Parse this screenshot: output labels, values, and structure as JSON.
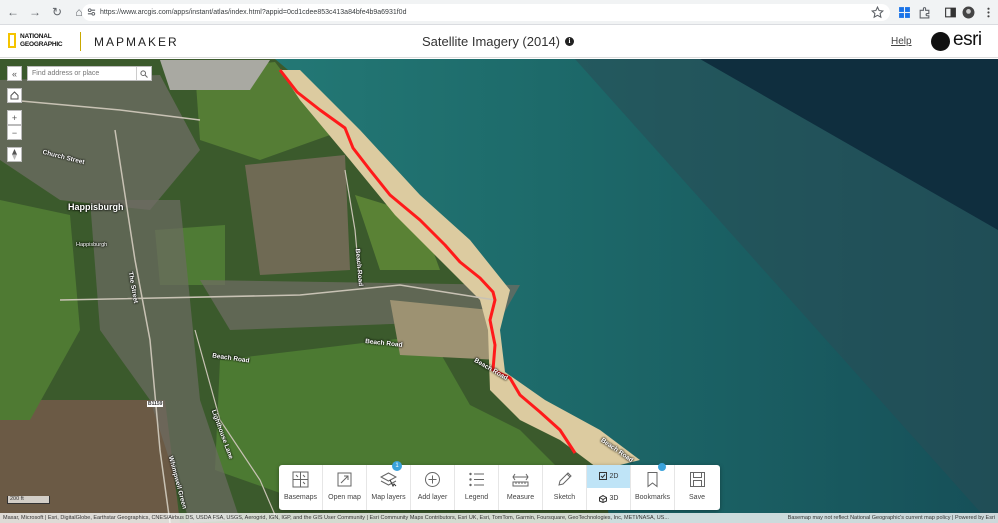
{
  "browser": {
    "url": "https://www.arcgis.com/apps/instant/atlas/index.html?appid=0cd1cdee853c413a84bfe4b9a6931f0d"
  },
  "header": {
    "brand_line1": "NATIONAL",
    "brand_line2": "GEOGRAPHIC",
    "app_name": "MAPMAKER",
    "map_title": "Satellite Imagery (2014)",
    "info_glyph": "i",
    "help_label": "Help",
    "esri_logo": "esri"
  },
  "map": {
    "search_placeholder": "Find address or place",
    "collapse_glyph": "«",
    "zoom_in_glyph": "+",
    "zoom_out_glyph": "−",
    "labels": {
      "church_street": "Church Street",
      "happisburgh": "Happisburgh",
      "beach_road_west": "Beach Road",
      "beach_road_mid": "Beach Road",
      "beach_road_east": "Beach Road",
      "beach_road_vertical": "Beach Road",
      "the_street": "The Street",
      "lighthouse_lane": "Lighthouse Lane",
      "whimpwell_green": "Whimpwell Green",
      "b1159": "B1159",
      "b1159_2": "B1159",
      "hadisburgh": "Happisburgh"
    },
    "scale_label": "200 ft",
    "attribution_left": "Maxar, Microsoft | Esri, DigitalGlobe, Earthstar Geographics, CNES/Airbus DS, USDA FSA, USGS, Aerogrid, IGN, IGP, and the GIS User Community | Esri Community Maps Contributors, Esri UK, Esri, TomTom, Garmin, Foursquare, GeoTechnologies, Inc, METI/NASA, US...",
    "attribution_right": "Basemap may not reflect National Geographic's current map policy | Powered by Esri",
    "colors": {
      "sea": "#1f6f6c",
      "land": "#3d5a2a",
      "route": "#ff1a1a"
    }
  },
  "toolbar": {
    "tools": [
      {
        "name": "basemaps",
        "label": "Basemaps"
      },
      {
        "name": "open-map",
        "label": "Open map"
      },
      {
        "name": "map-layers",
        "label": "Map layers",
        "badge": "1"
      },
      {
        "name": "add-layer",
        "label": "Add layer"
      },
      {
        "name": "legend",
        "label": "Legend"
      },
      {
        "name": "measure",
        "label": "Measure"
      },
      {
        "name": "sketch",
        "label": "Sketch"
      }
    ],
    "view_2d": "2D",
    "view_3d": "3D",
    "bookmarks_label": "Bookmarks",
    "save_label": "Save"
  }
}
